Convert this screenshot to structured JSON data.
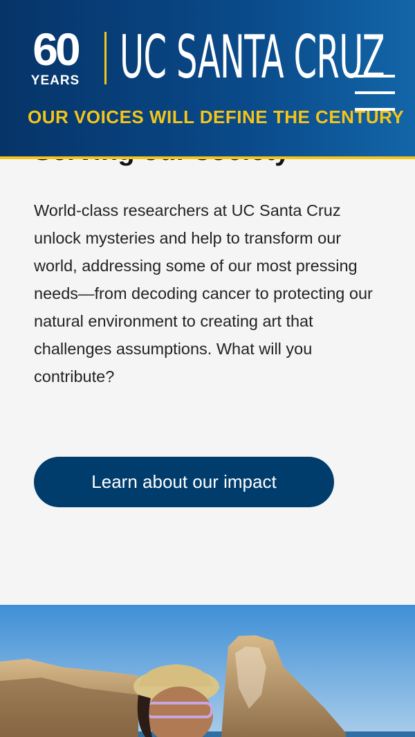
{
  "header": {
    "anniversary_number": "60",
    "anniversary_word": "YEARS",
    "university_name": "UC SANTA CRUZ",
    "tagline": "OUR VOICES WILL DEFINE THE CENTURY",
    "menu_icon": "hamburger-menu-icon"
  },
  "section": {
    "title": "Serving our society",
    "body": "World-class researchers at UC Santa Cruz unlock mysteries and help to transform our world, addressing some of our most pressing needs—from decoding cancer to protecting our natural environment to creating art that challenges assumptions. What will you contribute?",
    "cta_label": "Learn about our impact"
  },
  "colors": {
    "header_blue": "#063468",
    "accent_gold": "#f5c518",
    "button_navy": "#003c6c",
    "page_bg": "#f5f5f5"
  }
}
